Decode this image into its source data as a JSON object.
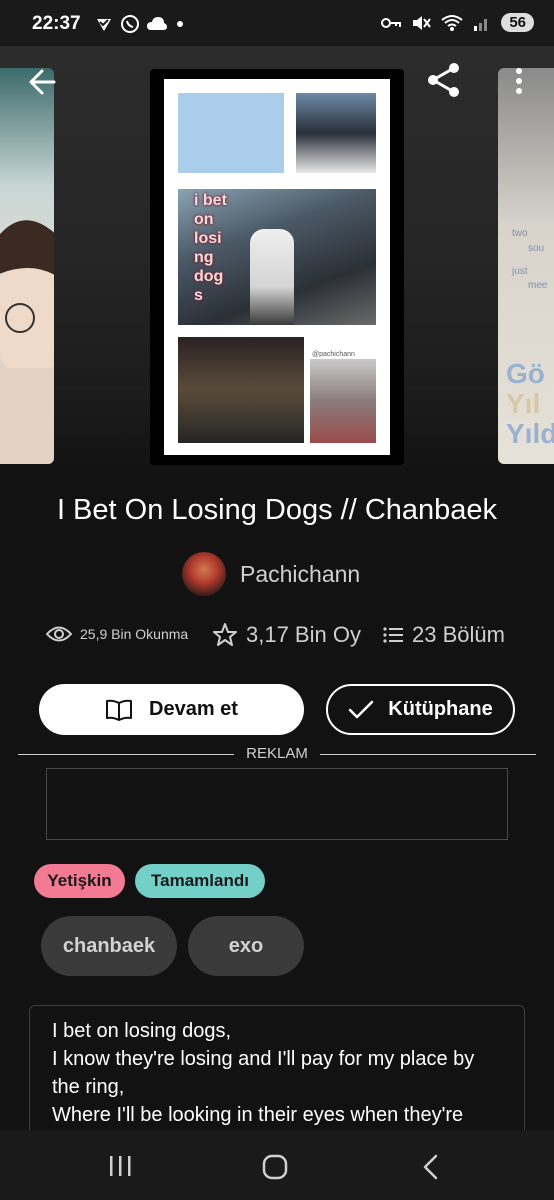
{
  "status_bar": {
    "time": "22:37",
    "battery": "56",
    "icons": [
      "verified-icon",
      "whatsapp-icon",
      "cloud-icon",
      "dot-icon",
      "key-icon",
      "mute-icon",
      "wifi-icon",
      "signal-icon"
    ]
  },
  "header": {
    "back_icon": "arrow-left-icon",
    "share_icon": "share-icon",
    "more_icon": "more-vertical-icon"
  },
  "cover": {
    "title_lines": [
      "i bet",
      "on",
      "losi",
      "ng",
      "dog",
      "s"
    ],
    "watermark": "@pachichann"
  },
  "side_covers": {
    "right_text": [
      "Gö",
      "Yıl",
      "Yıld"
    ],
    "right_small": [
      "two",
      "sou",
      "just",
      "mee"
    ]
  },
  "story": {
    "title": "I Bet On Losing Dogs // Chanbaek",
    "author": "Pachichann",
    "reads": "25,9 Bin Okunma",
    "votes": "3,17 Bin Oy",
    "parts": "23 Bölüm"
  },
  "actions": {
    "continue_label": "Devam et",
    "library_label": "Kütüphane"
  },
  "ad": {
    "label": "REKLAM"
  },
  "badges": [
    {
      "label": "Yetişkin",
      "color": "#f27a92"
    },
    {
      "label": "Tamamlandı",
      "color": "#72d0c8"
    }
  ],
  "tags": [
    "chanbaek",
    "exo"
  ],
  "description": {
    "lines": [
      "I bet on losing dogs,",
      "I know they're losing and I'll pay for my place by",
      "the ring,",
      "Where I'll be looking in their eyes when they're"
    ]
  },
  "nav": {
    "recent_icon": "recent-apps-icon",
    "home_icon": "home-icon",
    "back_icon": "back-chevron-icon"
  }
}
